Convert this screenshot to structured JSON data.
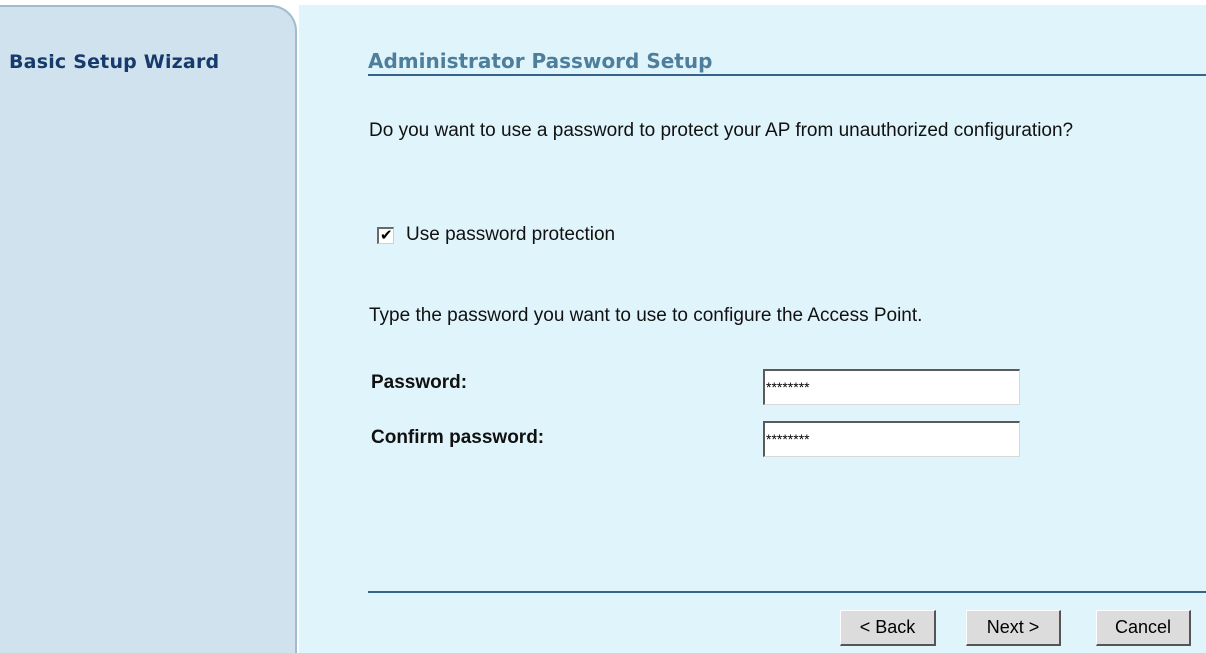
{
  "sidebar": {
    "title": "Basic Setup Wizard"
  },
  "main": {
    "title": "Administrator Password Setup",
    "question": "Do you want to use a password to protect your AP from unauthorized configuration?",
    "checkbox": {
      "label": "Use password protection",
      "checked": true
    },
    "instruction": "Type the password you want to use to configure the Access Point.",
    "fields": {
      "password_label": "Password:",
      "password_value": "********",
      "confirm_label": "Confirm password:",
      "confirm_value": "********"
    },
    "buttons": {
      "back": "< Back",
      "next": "Next >",
      "cancel": "Cancel"
    }
  },
  "colors": {
    "sidebar_bg": "#cfe2ee",
    "main_bg": "#e0f4fb",
    "title": "#4d7f9d",
    "sidebar_title": "#163a6b",
    "rule": "#36638a"
  },
  "icons": {
    "checkbox": "checkmark-icon"
  }
}
